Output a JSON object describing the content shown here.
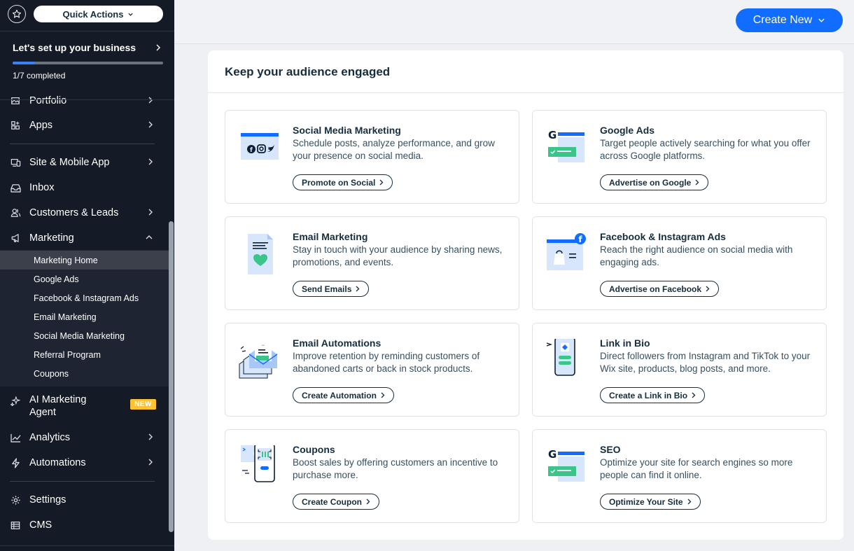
{
  "sidebar": {
    "quick_actions": "Quick Actions",
    "setup": {
      "title": "Let's set up your business",
      "progress": 0.143,
      "completed": "1/7 completed"
    },
    "nav": [
      {
        "label": "Portfolio",
        "icon": "portfolio-icon"
      },
      {
        "label": "Apps",
        "icon": "apps-icon"
      },
      {
        "label": "Site & Mobile App",
        "icon": "site-mobile-icon"
      },
      {
        "label": "Inbox",
        "icon": "inbox-icon"
      },
      {
        "label": "Customers & Leads",
        "icon": "customers-icon"
      },
      {
        "label": "Marketing",
        "icon": "megaphone-icon"
      }
    ],
    "marketing_sub": [
      "Marketing Home",
      "Google Ads",
      "Facebook & Instagram Ads",
      "Email Marketing",
      "Social Media Marketing",
      "Referral Program",
      "Coupons"
    ],
    "ai_agent": {
      "line1": "AI Marketing",
      "line2": "Agent",
      "badge": "NEW"
    },
    "nav2": [
      {
        "label": "Analytics",
        "icon": "analytics-icon"
      },
      {
        "label": "Automations",
        "icon": "automations-icon"
      }
    ],
    "nav3": [
      {
        "label": "Settings",
        "icon": "settings-icon"
      },
      {
        "label": "CMS",
        "icon": "cms-icon"
      }
    ]
  },
  "header": {
    "create_new": "Create New"
  },
  "main": {
    "title": "Keep your audience engaged",
    "tiles": [
      {
        "title": "Social Media Marketing",
        "desc": "Schedule posts, analyze performance, and grow your presence on social media.",
        "button": "Promote on Social"
      },
      {
        "title": "Google Ads",
        "desc": "Target people actively searching for what you offer across Google platforms.",
        "button": "Advertise on Google"
      },
      {
        "title": "Email Marketing",
        "desc": "Stay in touch with your audience by sharing news, promotions, and events.",
        "button": "Send Emails"
      },
      {
        "title": "Facebook & Instagram Ads",
        "desc": "Reach the right audience on social media with engaging ads.",
        "button": "Advertise on Facebook"
      },
      {
        "title": "Email Automations",
        "desc": "Improve retention by reminding customers of abandoned carts or back in stock products.",
        "button": "Create Automation"
      },
      {
        "title": "Link in Bio",
        "desc": "Direct followers from Instagram and TikTok to your Wix site, products, blog posts, and more.",
        "button": "Create a Link in Bio"
      },
      {
        "title": "Coupons",
        "desc": "Boost sales by offering customers an incentive to purchase more.",
        "button": "Create Coupon"
      },
      {
        "title": "SEO",
        "desc": "Optimize your site for search engines so more people can find it online.",
        "button": "Optimize Your Site"
      }
    ]
  },
  "colors": {
    "accent": "#116dff",
    "sidebar_bg": "#151b26",
    "badge": "#ffc233"
  }
}
